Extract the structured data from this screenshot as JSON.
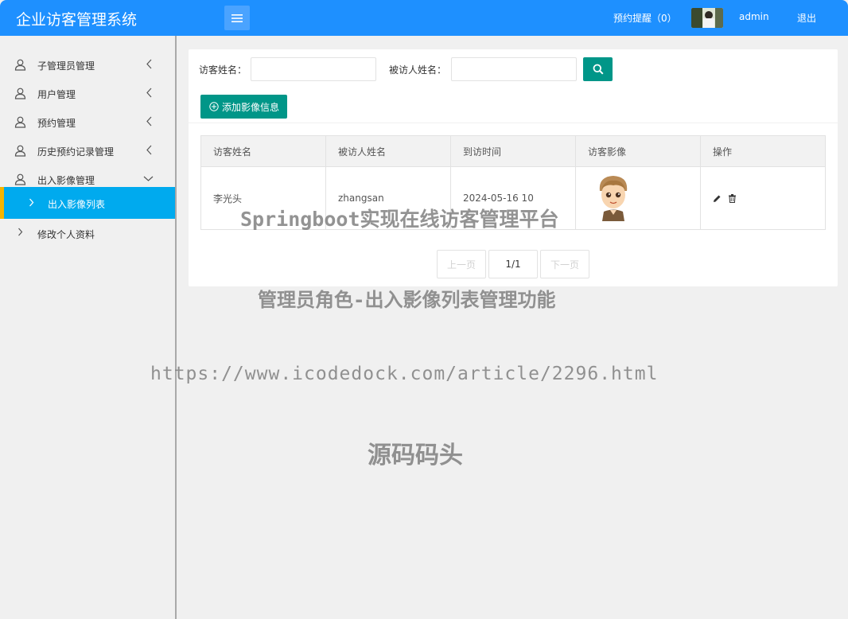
{
  "header": {
    "title": "企业访客管理系统",
    "reminder": "预约提醒（0）",
    "username": "admin",
    "logout": "退出"
  },
  "sidebar": {
    "items": [
      {
        "label": "子管理员管理",
        "icon": "user-icon",
        "arrow": "chevron-left-icon"
      },
      {
        "label": "用户管理",
        "icon": "user-icon",
        "arrow": "chevron-left-icon"
      },
      {
        "label": "预约管理",
        "icon": "user-icon",
        "arrow": "chevron-left-icon"
      },
      {
        "label": "历史预约记录管理",
        "icon": "user-icon",
        "arrow": "chevron-left-icon"
      },
      {
        "label": "出入影像管理",
        "icon": "user-icon",
        "arrow": "chevron-down-icon"
      }
    ],
    "active_sub": "出入影像列表",
    "profile": "修改个人资料"
  },
  "search": {
    "visitor_label": "访客姓名：",
    "visitor_value": "",
    "host_label": "被访人姓名：",
    "host_value": "",
    "add_button": "添加影像信息"
  },
  "table": {
    "columns": [
      "访客姓名",
      "被访人姓名",
      "到访时间",
      "访客影像",
      "操作"
    ],
    "rows": [
      {
        "visitor": "李光头",
        "host": "zhangsan",
        "time": "2024-05-16 10",
        "image": "cartoon-boy-avatar"
      }
    ]
  },
  "pager": {
    "prev": "上一页",
    "current": "1/1",
    "next": "下一页"
  },
  "watermarks": {
    "line1": "Springboot实现在线访客管理平台",
    "line2": "管理员角色-出入影像列表管理功能",
    "line3": "https://www.icodedock.com/article/2296.html",
    "line4": "源码码头"
  },
  "colors": {
    "header": "#1e90ff",
    "primary": "#009688",
    "active_nav": "#00aaee",
    "active_bar": "#f5b400"
  }
}
